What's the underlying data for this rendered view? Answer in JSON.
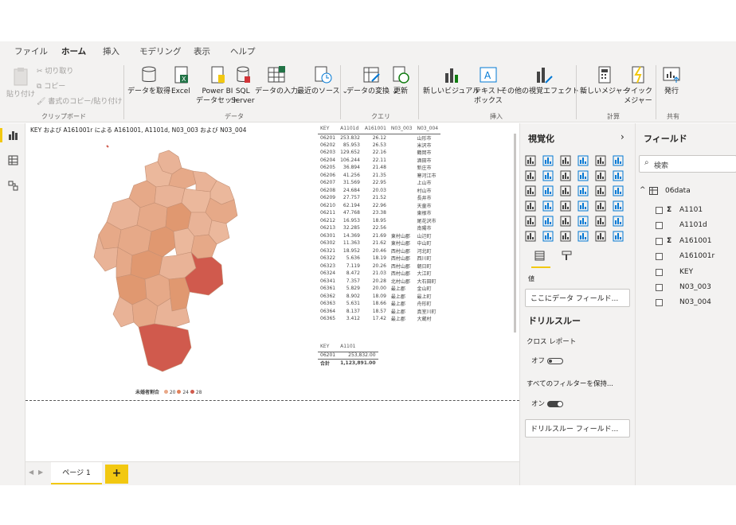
{
  "menu_tabs": [
    "ファイル",
    "ホーム",
    "挿入",
    "モデリング",
    "表示",
    "ヘルプ"
  ],
  "ribbon": {
    "paste": "貼り付け",
    "cut": "切り取り",
    "copy": "コピー",
    "format_copy": "書式のコピー/貼り付け",
    "get_data": "データを取得",
    "excel": "Excel",
    "powerbi_1": "Power BI",
    "powerbi_2": "データセット",
    "sql_1": "SQL",
    "sql_2": "Server",
    "enter_data": "データの入力",
    "recent_1": "最近のソース",
    "transform": "データの変換",
    "refresh": "更新",
    "new_visual": "新しいビジュアル",
    "textbox_1": "テキスト",
    "textbox_2": "ボックス",
    "more_visuals": "その他の視覚エフェクト",
    "new_measure": "新しいメジャー",
    "quick_1": "クイック",
    "quick_2": "メジャー",
    "publish": "発行",
    "groups": {
      "clipboard": "クリップボード",
      "data": "データ",
      "query": "クエリ",
      "insert": "挿入",
      "calc": "計算",
      "share": "共有"
    }
  },
  "map": {
    "title": "KEY および A161001r による A161001, A1101d, N03_003 および N03_004",
    "legend_title": "未婚者割合",
    "legend": [
      {
        "label": "20",
        "color": "#e9a888"
      },
      {
        "label": "24",
        "color": "#e07f59"
      },
      {
        "label": "28",
        "color": "#d05a4d"
      }
    ]
  },
  "table1": {
    "headers": [
      "KEY",
      "A1101d",
      "A161001",
      "N03_003",
      "N03_004"
    ],
    "rows": [
      [
        "06201",
        "253.832",
        "26.12",
        "",
        "山形市"
      ],
      [
        "06202",
        "85.953",
        "26.53",
        "",
        "米沢市"
      ],
      [
        "06203",
        "129.652",
        "22.16",
        "",
        "鶴岡市"
      ],
      [
        "06204",
        "106.244",
        "22.11",
        "",
        "酒田市"
      ],
      [
        "06205",
        "36.894",
        "21.48",
        "",
        "新庄市"
      ],
      [
        "06206",
        "41.256",
        "21.35",
        "",
        "寒河江市"
      ],
      [
        "06207",
        "31.569",
        "22.95",
        "",
        "上山市"
      ],
      [
        "06208",
        "24.684",
        "20.03",
        "",
        "村山市"
      ],
      [
        "06209",
        "27.757",
        "21.52",
        "",
        "長井市"
      ],
      [
        "06210",
        "62.194",
        "22.96",
        "",
        "天童市"
      ],
      [
        "06211",
        "47.768",
        "23.38",
        "",
        "東根市"
      ],
      [
        "06212",
        "16.953",
        "18.95",
        "",
        "尾花沢市"
      ],
      [
        "06213",
        "32.285",
        "22.56",
        "",
        "南陽市"
      ],
      [
        "06301",
        "14.369",
        "21.69",
        "東村山郡",
        "山辺町"
      ],
      [
        "06302",
        "11.363",
        "21.62",
        "東村山郡",
        "中山町"
      ],
      [
        "06321",
        "18.952",
        "20.46",
        "西村山郡",
        "河北町"
      ],
      [
        "06322",
        "5.636",
        "18.19",
        "西村山郡",
        "西川町"
      ],
      [
        "06323",
        "7.119",
        "20.26",
        "西村山郡",
        "朝日町"
      ],
      [
        "06324",
        "8.472",
        "21.03",
        "西村山郡",
        "大江町"
      ],
      [
        "06341",
        "7.357",
        "20.28",
        "北村山郡",
        "大石田町"
      ],
      [
        "06361",
        "5.829",
        "20.00",
        "最上郡",
        "金山町"
      ],
      [
        "06362",
        "8.902",
        "18.09",
        "最上郡",
        "最上町"
      ],
      [
        "06363",
        "5.631",
        "18.66",
        "最上郡",
        "舟形町"
      ],
      [
        "06364",
        "8.137",
        "18.57",
        "最上郡",
        "真室川町"
      ],
      [
        "06365",
        "3.412",
        "17.42",
        "最上郡",
        "大蔵村"
      ]
    ]
  },
  "table2": {
    "headers": [
      "KEY",
      "A1101"
    ],
    "rows": [
      [
        "06201",
        "253,832.00"
      ]
    ],
    "total_label": "合計",
    "total_value": "1,123,891.00"
  },
  "pages": {
    "tab": "ページ 1",
    "add": "+"
  },
  "viz_pane": {
    "title": "視覚化",
    "values_label": "値",
    "add_field": "ここにデータ フィールド...",
    "drill_title": "ドリルスルー",
    "cross_report": "クロス レポート",
    "off": "オフ",
    "keep_filters": "すべてのフィルターを保持...",
    "on": "オン",
    "drill_field": "ドリルスルー フィールド..."
  },
  "fields_pane": {
    "title": "フィールド",
    "search_placeholder": "検索",
    "table": "06data",
    "fields": [
      {
        "name": "A1101",
        "sigma": true
      },
      {
        "name": "A1101d",
        "sigma": false
      },
      {
        "name": "A161001",
        "sigma": true
      },
      {
        "name": "A161001r",
        "sigma": false
      },
      {
        "name": "KEY",
        "sigma": false
      },
      {
        "name": "N03_003",
        "sigma": false
      },
      {
        "name": "N03_004",
        "sigma": false
      }
    ]
  }
}
